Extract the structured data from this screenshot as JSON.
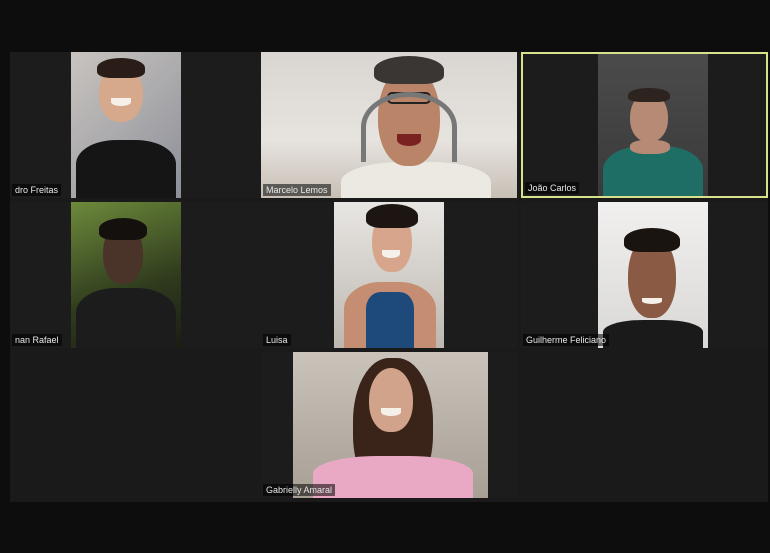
{
  "participants": [
    {
      "name": "dro Freitas"
    },
    {
      "name": "Marcelo Lemos"
    },
    {
      "name": "João Carlos",
      "active_speaker": true
    },
    {
      "name": "nan Rafael"
    },
    {
      "name": "Luisa"
    },
    {
      "name": "Guilherme Feliciano"
    },
    {
      "name": "Gabrielly Amaral"
    }
  ],
  "colors": {
    "background": "#0d0d0d",
    "tile": "#1c1c1c",
    "active_border": "#d9e28a",
    "name_label_text": "#e9e9e9"
  }
}
